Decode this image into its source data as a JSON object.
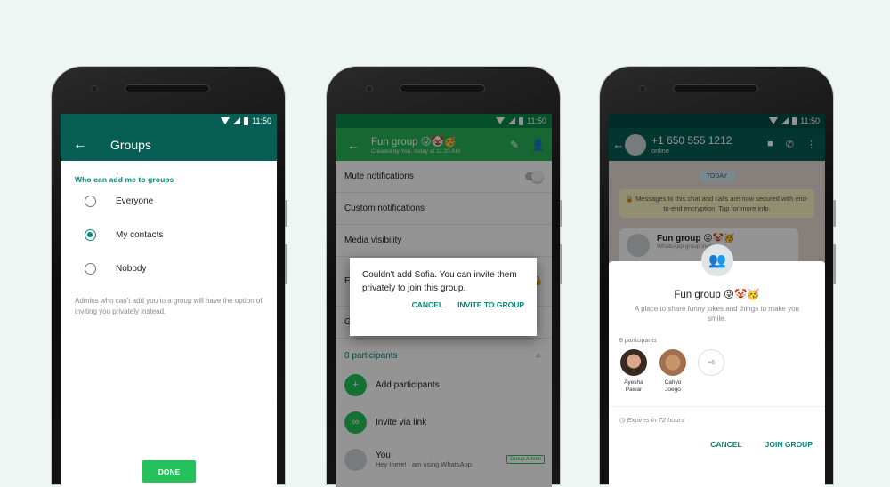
{
  "status_time": "11:50",
  "phone1": {
    "title": "Groups",
    "section_label": "Who can add me to groups",
    "options": [
      {
        "label": "Everyone",
        "selected": false
      },
      {
        "label": "My contacts",
        "selected": true
      },
      {
        "label": "Nobody",
        "selected": false
      }
    ],
    "help_text": "Admins who can't add you to a group will have the option of inviting you privately instead.",
    "done_label": "DONE"
  },
  "phone2": {
    "group_name": "Fun group 😜🤡🥳",
    "group_subtitle": "Created by You, today at 11:20 AM",
    "settings": [
      {
        "label": "Mute notifications"
      },
      {
        "label": "Custom notifications"
      },
      {
        "label": "Media visibility"
      },
      {
        "label": "Encryption"
      },
      {
        "label": "Group settings"
      }
    ],
    "participants_header": "8 participants",
    "add_participants": "Add participants",
    "invite_via_link": "Invite via link",
    "you_name": "You",
    "you_status": "Hey there! I am using WhatsApp.",
    "admin_badge": "Group Admin",
    "dialog": {
      "message": "Couldn't add Sofia. You can invite them privately to join this group.",
      "cancel": "CANCEL",
      "invite": "INVITE TO GROUP"
    }
  },
  "phone3": {
    "contact": "+1 650 555 1212",
    "presence": "online",
    "date_chip": "TODAY",
    "encryption_notice": "🔒 Messages to this chat and calls are now secured with end-to-end encryption. Tap for more info.",
    "bubble_title": "Fun group 😜🤡🥳",
    "bubble_sub": "WhatsApp group invite",
    "sheet": {
      "group_name": "Fun group 😜🤡🥳",
      "description": "A place to share funny jokes and things to make you smile.",
      "participants_count": "8 participants",
      "members": [
        {
          "name": "Ayesha Pawar"
        },
        {
          "name": "Cahyo Joego"
        }
      ],
      "more": "+6",
      "expires": "Expires in 72 hours",
      "cancel": "CANCEL",
      "join": "JOIN GROUP"
    }
  }
}
